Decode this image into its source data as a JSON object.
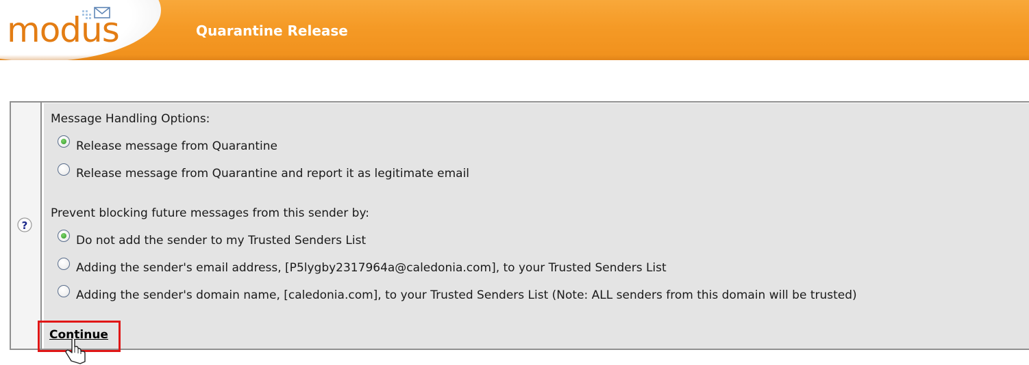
{
  "header": {
    "logo_text": "modus",
    "title": "Quarantine Release",
    "logo_icon": "envelope-icon",
    "colors": {
      "orange": "#f59a26",
      "logo": "#e37d14"
    }
  },
  "help": {
    "icon": "question-mark-icon"
  },
  "handling": {
    "heading": "Message Handling Options:",
    "options": [
      {
        "label": "Release message from Quarantine",
        "selected": true
      },
      {
        "label": "Release message from Quarantine and report it as legitimate email",
        "selected": false
      }
    ]
  },
  "trusted": {
    "heading": "Prevent blocking future messages from this sender by:",
    "options": [
      {
        "label": "Do not add the sender to my Trusted Senders List",
        "selected": true
      },
      {
        "label": "Adding the sender's email address, [P5lygby2317964a@caledonia.com], to your Trusted Senders List",
        "selected": false
      },
      {
        "label": "Adding the sender's domain name, [caledonia.com], to your Trusted Senders List (Note: ALL senders from this domain will be trusted)",
        "selected": false
      }
    ]
  },
  "actions": {
    "continue_label": "Continue",
    "highlight_color": "#e01616"
  },
  "cursor": {
    "icon": "hand-pointer-icon"
  }
}
